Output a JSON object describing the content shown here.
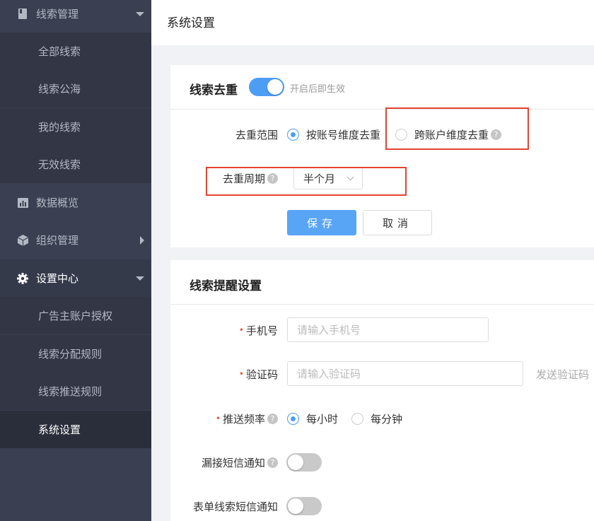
{
  "sidebar": {
    "items": [
      {
        "label": "线索管理",
        "icon": "book-icon"
      },
      {
        "label": "全部线索"
      },
      {
        "label": "线索公海"
      },
      {
        "label": "我的线索"
      },
      {
        "label": "无效线索"
      },
      {
        "label": "数据概览",
        "icon": "bar-chart-icon"
      },
      {
        "label": "组织管理",
        "icon": "cube-icon"
      },
      {
        "label": "设置中心",
        "icon": "gear-icon"
      },
      {
        "label": "广告主账户授权"
      },
      {
        "label": "线索分配规则"
      },
      {
        "label": "线索推送规则"
      },
      {
        "label": "系统设置"
      }
    ]
  },
  "header": {
    "title": "系统设置"
  },
  "dedup": {
    "title": "线索去重",
    "toggle_on": true,
    "toggle_hint": "开启后即生效",
    "scope_label": "去重范围",
    "scope_options": [
      "按账号维度去重",
      "跨账户维度去重"
    ],
    "scope_selected": "按账号维度去重",
    "period_label": "去重周期",
    "period_value": "半个月",
    "save_label": "保存",
    "cancel_label": "取消"
  },
  "reminder": {
    "title": "线索提醒设置",
    "phone_label": "手机号",
    "phone_placeholder": "请输入手机号",
    "code_label": "验证码",
    "code_placeholder": "请输入验证码",
    "send_code_label": "发送验证码",
    "freq_label": "推送频率",
    "freq_options": [
      "每小时",
      "每分钟"
    ],
    "freq_selected": "每小时",
    "missed_label": "漏接短信通知",
    "missed_on": false,
    "form_label": "表单线索短信通知",
    "form_on": false
  },
  "colors": {
    "accent": "#4e9df5",
    "sidebar_bg": "#3a3f51",
    "highlight_box": "#e5432f",
    "required": "#e85a3a"
  }
}
